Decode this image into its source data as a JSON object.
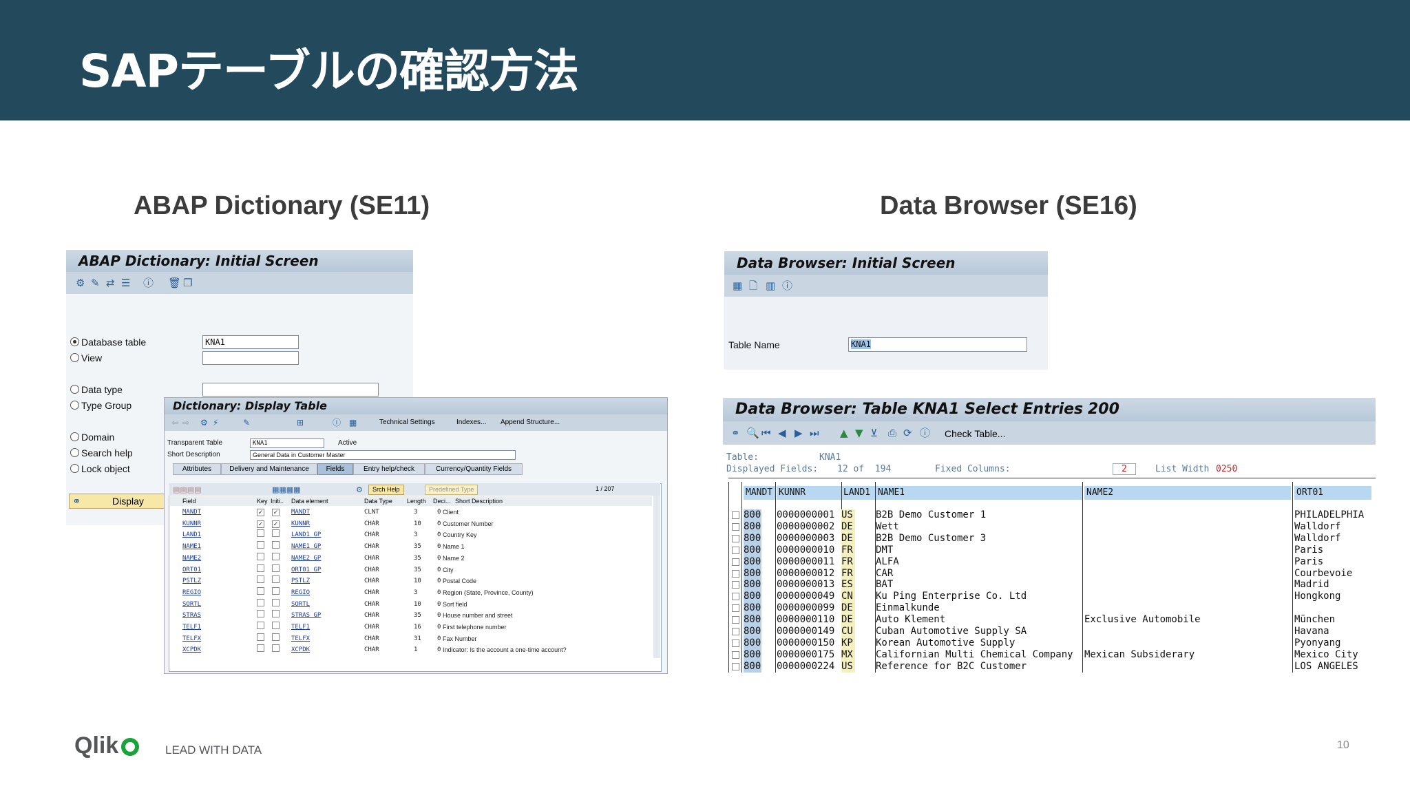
{
  "slide": {
    "title": "SAPテーブルの確認方法",
    "page_number": "10"
  },
  "sections": {
    "left": "ABAP Dictionary (SE11)",
    "right": "Data Browser (SE16)"
  },
  "se11": {
    "title": "ABAP Dictionary: Initial Screen",
    "radios": {
      "database_table": "Database table",
      "view": "View",
      "data_type": "Data type",
      "type_group": "Type Group",
      "domain": "Domain",
      "search_help": "Search help",
      "lock_object": "Lock object"
    },
    "database_table_value": "KNA1",
    "display_button": "Display"
  },
  "display_table": {
    "title": "Dictionary: Display Table",
    "toolbar": {
      "technical_settings": "Technical Settings",
      "indexes": "Indexes...",
      "append_structure": "Append Structure..."
    },
    "transparent_table_label": "Transparent Table",
    "transparent_table_value": "KNA1",
    "status": "Active",
    "short_description_label": "Short Description",
    "short_description_value": "General Data in Customer Master",
    "tabs": [
      "Attributes",
      "Delivery and Maintenance",
      "Fields",
      "Entry help/check",
      "Currency/Quantity Fields"
    ],
    "active_tab": "Fields",
    "srch_help": "Srch Help",
    "predefined_type": "Predefined Type",
    "pager": "1  /  207",
    "columns": [
      "Field",
      "Key",
      "Initi..",
      "Data element",
      "Data Type",
      "Length",
      "Deci...",
      "Short Description"
    ],
    "rows": [
      {
        "field": "MANDT",
        "key": true,
        "init": true,
        "elem": "MANDT",
        "type": "CLNT",
        "len": "3",
        "dec": "0",
        "desc": "Client"
      },
      {
        "field": "KUNNR",
        "key": true,
        "init": true,
        "elem": "KUNNR",
        "type": "CHAR",
        "len": "10",
        "dec": "0",
        "desc": "Customer Number"
      },
      {
        "field": "LAND1",
        "key": false,
        "init": false,
        "elem": "LAND1_GP",
        "type": "CHAR",
        "len": "3",
        "dec": "0",
        "desc": "Country Key"
      },
      {
        "field": "NAME1",
        "key": false,
        "init": false,
        "elem": "NAME1_GP",
        "type": "CHAR",
        "len": "35",
        "dec": "0",
        "desc": "Name 1"
      },
      {
        "field": "NAME2",
        "key": false,
        "init": false,
        "elem": "NAME2_GP",
        "type": "CHAR",
        "len": "35",
        "dec": "0",
        "desc": "Name 2"
      },
      {
        "field": "ORT01",
        "key": false,
        "init": false,
        "elem": "ORT01_GP",
        "type": "CHAR",
        "len": "35",
        "dec": "0",
        "desc": "City"
      },
      {
        "field": "PSTLZ",
        "key": false,
        "init": false,
        "elem": "PSTLZ",
        "type": "CHAR",
        "len": "10",
        "dec": "0",
        "desc": "Postal Code"
      },
      {
        "field": "REGIO",
        "key": false,
        "init": false,
        "elem": "REGIO",
        "type": "CHAR",
        "len": "3",
        "dec": "0",
        "desc": "Region (State, Province, County)"
      },
      {
        "field": "SORTL",
        "key": false,
        "init": false,
        "elem": "SORTL",
        "type": "CHAR",
        "len": "10",
        "dec": "0",
        "desc": "Sort field"
      },
      {
        "field": "STRAS",
        "key": false,
        "init": false,
        "elem": "STRAS_GP",
        "type": "CHAR",
        "len": "35",
        "dec": "0",
        "desc": "House number and street"
      },
      {
        "field": "TELF1",
        "key": false,
        "init": false,
        "elem": "TELF1",
        "type": "CHAR",
        "len": "16",
        "dec": "0",
        "desc": "First telephone number"
      },
      {
        "field": "TELFX",
        "key": false,
        "init": false,
        "elem": "TELFX",
        "type": "CHAR",
        "len": "31",
        "dec": "0",
        "desc": "Fax Number"
      },
      {
        "field": "XCPDK",
        "key": false,
        "init": false,
        "elem": "XCPDK",
        "type": "CHAR",
        "len": "1",
        "dec": "0",
        "desc": "Indicator: Is the account a one-time account?"
      }
    ]
  },
  "se16_initial": {
    "title": "Data Browser: Initial Screen",
    "table_name_label": "Table Name",
    "table_name_value": "KNA1"
  },
  "se16_entries": {
    "title": "Data Browser: Table KNA1 Select Entries",
    "count": "200",
    "check_table": "Check Table...",
    "table_label": "Table:",
    "table_value": "KNA1",
    "displayed_fields_label": "Displayed Fields:",
    "displayed_fields": "12 of  194",
    "fixed_columns_label": "Fixed Columns:",
    "fixed_columns": "2",
    "list_width_label": "List Width",
    "list_width": "0250",
    "columns": [
      "MANDT",
      "KUNNR",
      "LAND1",
      "NAME1",
      "NAME2",
      "ORT01"
    ],
    "rows": [
      {
        "mandt": "800",
        "kunnr": "0000000001",
        "land1": "US",
        "name1": "B2B Demo Customer 1",
        "name2": "",
        "ort01": "PHILADELPHIA"
      },
      {
        "mandt": "800",
        "kunnr": "0000000002",
        "land1": "DE",
        "name1": "Wett",
        "name2": "",
        "ort01": "Walldorf"
      },
      {
        "mandt": "800",
        "kunnr": "0000000003",
        "land1": "DE",
        "name1": "B2B Demo Customer 3",
        "name2": "",
        "ort01": "Walldorf"
      },
      {
        "mandt": "800",
        "kunnr": "0000000010",
        "land1": "FR",
        "name1": "DMT",
        "name2": "",
        "ort01": "Paris"
      },
      {
        "mandt": "800",
        "kunnr": "0000000011",
        "land1": "FR",
        "name1": "ALFA",
        "name2": "",
        "ort01": "Paris"
      },
      {
        "mandt": "800",
        "kunnr": "0000000012",
        "land1": "FR",
        "name1": "CAR",
        "name2": "",
        "ort01": "Courbevoie"
      },
      {
        "mandt": "800",
        "kunnr": "0000000013",
        "land1": "ES",
        "name1": "BAT",
        "name2": "",
        "ort01": "Madrid"
      },
      {
        "mandt": "800",
        "kunnr": "0000000049",
        "land1": "CN",
        "name1": "Ku Ping Enterprise Co. Ltd",
        "name2": "",
        "ort01": "Hongkong"
      },
      {
        "mandt": "800",
        "kunnr": "0000000099",
        "land1": "DE",
        "name1": "Einmalkunde",
        "name2": "",
        "ort01": ""
      },
      {
        "mandt": "800",
        "kunnr": "0000000110",
        "land1": "DE",
        "name1": "Auto Klement",
        "name2": "Exclusive Automobile",
        "ort01": "München"
      },
      {
        "mandt": "800",
        "kunnr": "0000000149",
        "land1": "CU",
        "name1": "Cuban Automotive Supply SA",
        "name2": "",
        "ort01": "Havana"
      },
      {
        "mandt": "800",
        "kunnr": "0000000150",
        "land1": "KP",
        "name1": "Korean Automotive Supply",
        "name2": "",
        "ort01": "Pyonyang"
      },
      {
        "mandt": "800",
        "kunnr": "0000000175",
        "land1": "MX",
        "name1": "Californian Multi Chemical Company",
        "name2": "Mexican Subsiderary",
        "ort01": "Mexico City"
      },
      {
        "mandt": "800",
        "kunnr": "0000000224",
        "land1": "US",
        "name1": "Reference for B2C Customer",
        "name2": "",
        "ort01": "LOS ANGELES"
      }
    ]
  },
  "footer": {
    "logo": "Qlik",
    "tagline": "LEAD WITH DATA"
  },
  "colors": {
    "header_bg": "#234a5c",
    "sap_panel": "#dde4ec",
    "column_header": "#b8d8f2"
  }
}
